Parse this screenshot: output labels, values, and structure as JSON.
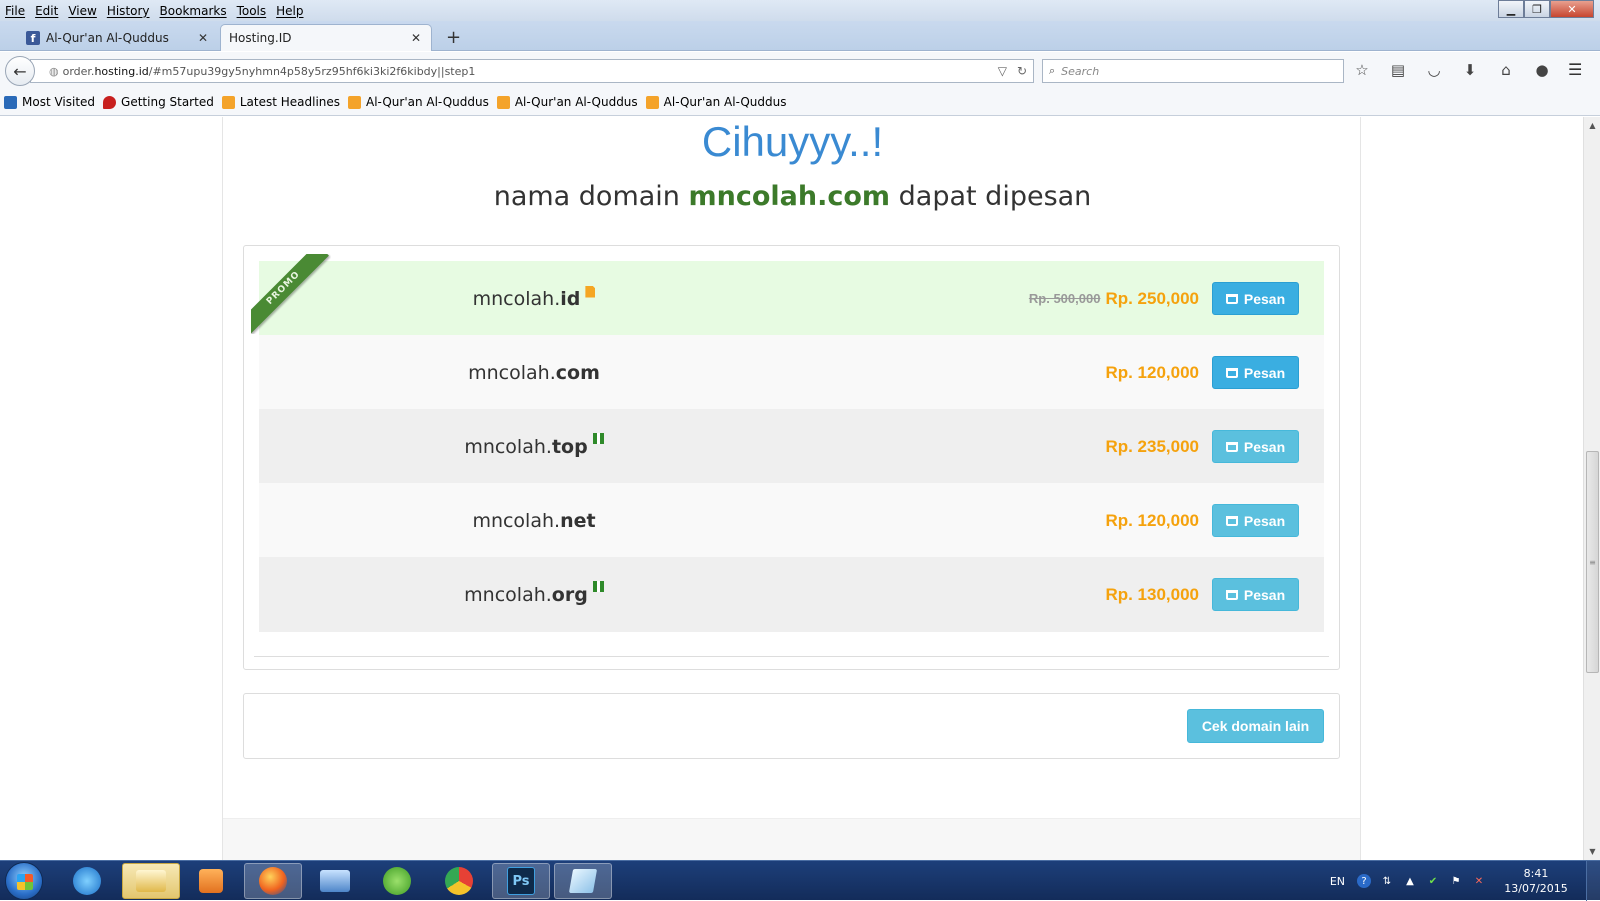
{
  "menu": [
    "File",
    "Edit",
    "View",
    "History",
    "Bookmarks",
    "Tools",
    "Help"
  ],
  "tabs": [
    {
      "label": "Al-Qur'an Al-Quddus",
      "active": false
    },
    {
      "label": "Hosting.ID",
      "active": true
    }
  ],
  "nav": {
    "url_prefix": "order.",
    "url_host": "hosting.id",
    "url_path": "/#m57upu39gy5nyhmn4p58y5rz95hf6ki3ki2f6kibdy||step1",
    "search_placeholder": "Search"
  },
  "bookmarks": [
    {
      "label": "Most Visited",
      "icon": "most-visited-icon"
    },
    {
      "label": "Getting Started",
      "icon": "firefox-icon"
    },
    {
      "label": "Latest Headlines",
      "icon": "rss-icon"
    },
    {
      "label": "Al-Qur'an Al-Quddus",
      "icon": "rss-icon"
    },
    {
      "label": "Al-Qur'an Al-Quddus",
      "icon": "rss-icon"
    },
    {
      "label": "Al-Qur'an Al-Quddus",
      "icon": "rss-icon"
    }
  ],
  "page": {
    "title": "Cihuyyy..!",
    "subtitle_prefix": "nama domain ",
    "subtitle_domain": "mncolah.com",
    "subtitle_suffix": " dapat dipesan",
    "promo_label": "PROMO",
    "order_label": "Pesan",
    "other_domain_label": "Cek domain lain",
    "results": [
      {
        "name": "mncolah.",
        "tld": "id",
        "badge": "file-icon",
        "old_price": "Rp. 500,000",
        "price": "Rp. 250,000",
        "promo": true
      },
      {
        "name": "mncolah.",
        "tld": "com",
        "badge": "",
        "old_price": "",
        "price": "Rp. 120,000",
        "promo": false
      },
      {
        "name": "mncolah.",
        "tld": "top",
        "badge": "gift-icon",
        "old_price": "",
        "price": "Rp. 235,000",
        "promo": false
      },
      {
        "name": "mncolah.",
        "tld": "net",
        "badge": "",
        "old_price": "",
        "price": "Rp. 120,000",
        "promo": false
      },
      {
        "name": "mncolah.",
        "tld": "org",
        "badge": "gift-icon",
        "old_price": "",
        "price": "Rp. 130,000",
        "promo": false
      }
    ]
  },
  "taskbar": {
    "apps": [
      "internet-explorer-icon",
      "file-explorer-icon",
      "media-player-icon",
      "firefox-icon",
      "remote-desktop-icon",
      "utorrent-icon",
      "chrome-icon",
      "photoshop-icon",
      "notes-icon"
    ],
    "photoshop_label": "Ps",
    "language": "EN",
    "time": "8:41",
    "date": "13/07/2015"
  },
  "colors": {
    "title_blue": "#3a8ad2",
    "domain_green": "#3c7a2a",
    "price_orange": "#f5a20d",
    "button_blue": "#3aaee1",
    "promo_row": "#e7fbe2"
  }
}
